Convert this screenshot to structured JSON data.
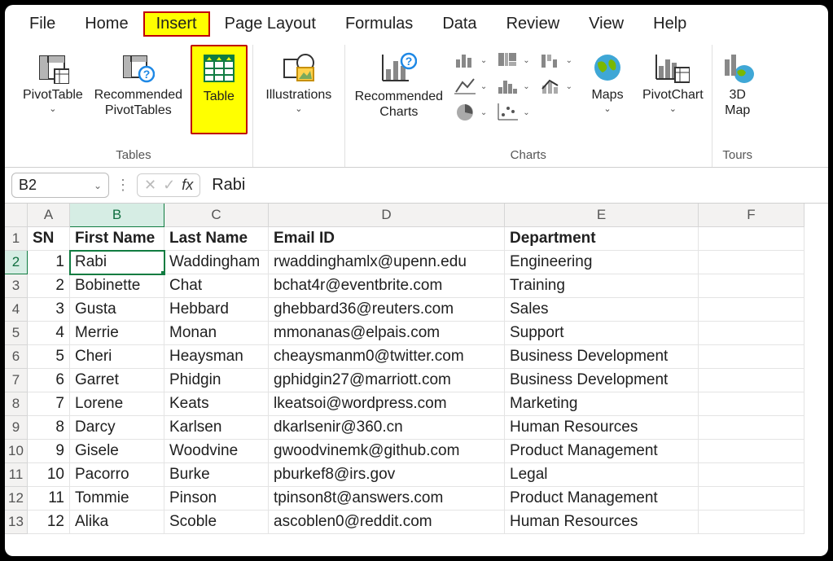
{
  "menubar": {
    "tabs": [
      "File",
      "Home",
      "Insert",
      "Page Layout",
      "Formulas",
      "Data",
      "Review",
      "View",
      "Help"
    ],
    "activeIndex": 2
  },
  "ribbon": {
    "groups": {
      "tables": {
        "label": "Tables",
        "pivot": "PivotTable",
        "recommendedPivot": "Recommended\nPivotTables",
        "table": "Table"
      },
      "illustrations": {
        "label": "Illustrations",
        "btn": "Illustrations"
      },
      "charts": {
        "label": "Charts",
        "recommended": "Recommended\nCharts",
        "maps": "Maps",
        "pivotchart": "PivotChart"
      },
      "tours": {
        "label": "Tours",
        "map3d": "3D\nMap"
      }
    }
  },
  "formula_bar": {
    "namebox": "B2",
    "value": "Rabi"
  },
  "columns": [
    "A",
    "B",
    "C",
    "D",
    "E",
    "F"
  ],
  "headerRow": {
    "sn": "SN",
    "first": "First Name",
    "last": "Last Name",
    "email": "Email ID",
    "dept": "Department"
  },
  "rows": [
    {
      "sn": 1,
      "first": "Rabi",
      "last": "Waddingham",
      "email": "rwaddinghamlx@upenn.edu",
      "dept": "Engineering"
    },
    {
      "sn": 2,
      "first": "Bobinette",
      "last": "Chat",
      "email": "bchat4r@eventbrite.com",
      "dept": "Training"
    },
    {
      "sn": 3,
      "first": "Gusta",
      "last": "Hebbard",
      "email": "ghebbard36@reuters.com",
      "dept": "Sales"
    },
    {
      "sn": 4,
      "first": "Merrie",
      "last": "Monan",
      "email": "mmonanas@elpais.com",
      "dept": "Support"
    },
    {
      "sn": 5,
      "first": "Cheri",
      "last": "Heaysman",
      "email": "cheaysmanm0@twitter.com",
      "dept": "Business Development"
    },
    {
      "sn": 6,
      "first": "Garret",
      "last": "Phidgin",
      "email": "gphidgin27@marriott.com",
      "dept": "Business Development"
    },
    {
      "sn": 7,
      "first": "Lorene",
      "last": "Keats",
      "email": "lkeatsoi@wordpress.com",
      "dept": "Marketing"
    },
    {
      "sn": 8,
      "first": "Darcy",
      "last": "Karlsen",
      "email": "dkarlsenir@360.cn",
      "dept": "Human Resources"
    },
    {
      "sn": 9,
      "first": "Gisele",
      "last": "Woodvine",
      "email": "gwoodvinemk@github.com",
      "dept": "Product Management"
    },
    {
      "sn": 10,
      "first": "Pacorro",
      "last": "Burke",
      "email": "pburkef8@irs.gov",
      "dept": "Legal"
    },
    {
      "sn": 11,
      "first": "Tommie",
      "last": "Pinson",
      "email": "tpinson8t@answers.com",
      "dept": "Product Management"
    },
    {
      "sn": 12,
      "first": "Alika",
      "last": "Scoble",
      "email": "ascoblen0@reddit.com",
      "dept": "Human Resources"
    }
  ],
  "selection": {
    "col": "B",
    "row": 2
  }
}
